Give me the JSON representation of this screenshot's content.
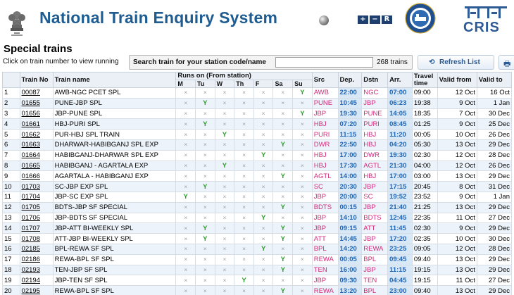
{
  "header": {
    "title": "National Train Enquiry System",
    "font_controls": [
      "+",
      "−",
      "R"
    ],
    "cris_logo_text": "CRIS",
    "ir_logo_text": "INDIAN RAILWAYS",
    "colors": {
      "title": "#1e5c91",
      "station": "#d12b7a",
      "time": "#1e64b4",
      "run_mark": "#2d9c2d"
    }
  },
  "page": {
    "section_title": "Special trains",
    "hint": "Click on train number to view running",
    "search_label": "Search train for your station code/name",
    "search_value": "",
    "search_placeholder": "",
    "train_count": "268 trains",
    "refresh_label": "Refresh List"
  },
  "table": {
    "headers": {
      "sno": "",
      "train_no": "Train No",
      "train_name": "Train name",
      "runs_on": "Runs on (From station)",
      "days": [
        "M",
        "Tu",
        "W",
        "Th",
        "F",
        "Sa",
        "Su"
      ],
      "src": "Src",
      "dep": "Dep.",
      "dstn": "Dstn",
      "arr": "Arr.",
      "travel": "Travel time",
      "valid_from": "Valid from",
      "valid_to": "Valid to"
    },
    "run_symbol": "Y",
    "off_symbol": "×",
    "rows": [
      {
        "sno": "1",
        "no": "00087",
        "name": "AWB-NGC PCET SPL",
        "days": "NNNNNNY",
        "src": "AWB",
        "dep": "22:00",
        "dstn": "NGC",
        "arr": "07:00",
        "travel": "09:00",
        "from": "12 Oct",
        "to": "16 Oct"
      },
      {
        "sno": "2",
        "no": "01655",
        "name": "PUNE-JBP SPL",
        "days": "NYNNNNN",
        "src": "PUNE",
        "dep": "10:45",
        "dstn": "JBP",
        "arr": "06:23",
        "travel": "19:38",
        "from": "9 Oct",
        "to": "1 Jan"
      },
      {
        "sno": "3",
        "no": "01656",
        "name": "JBP-PUNE SPL",
        "days": "NNNNNNY",
        "src": "JBP",
        "dep": "19:30",
        "dstn": "PUNE",
        "arr": "14:05",
        "travel": "18:35",
        "from": "7 Oct",
        "to": "30 Dec"
      },
      {
        "sno": "4",
        "no": "01661",
        "name": "HBJ-PURI SPL",
        "days": "NYNNNNN",
        "src": "HBJ",
        "dep": "07:20",
        "dstn": "PURI",
        "arr": "08:45",
        "travel": "01:25",
        "from": "9 Oct",
        "to": "25 Dec"
      },
      {
        "sno": "5",
        "no": "01662",
        "name": "PUR-HBJ SPL TRAIN",
        "days": "NNYNNNN",
        "src": "PURI",
        "dep": "11:15",
        "dstn": "HBJ",
        "arr": "11:20",
        "travel": "00:05",
        "from": "10 Oct",
        "to": "26 Dec"
      },
      {
        "sno": "6",
        "no": "01663",
        "name": "DHARWAR-HABIBGANJ SPL EXP",
        "days": "NNNNNYN",
        "src": "DWR",
        "dep": "22:50",
        "dstn": "HBJ",
        "arr": "04:20",
        "travel": "05:30",
        "from": "13 Oct",
        "to": "29 Dec"
      },
      {
        "sno": "7",
        "no": "01664",
        "name": "HABIBGANJ-DHARWAR SPL EXP",
        "days": "NNNNYNN",
        "src": "HBJ",
        "dep": "17:00",
        "dstn": "DWR",
        "arr": "19:30",
        "travel": "02:30",
        "from": "12 Oct",
        "to": "28 Dec"
      },
      {
        "sno": "8",
        "no": "01665",
        "name": "HABIBGANJ - AGARTALA EXP",
        "days": "NNYNNNN",
        "src": "HBJ",
        "dep": "17:30",
        "dstn": "AGTL",
        "arr": "21:30",
        "travel": "04:00",
        "from": "12 Oct",
        "to": "26 Dec"
      },
      {
        "sno": "9",
        "no": "01666",
        "name": "AGARTALA - HABIBGANJ EXP",
        "days": "NNNNNYN",
        "src": "AGTL",
        "dep": "14:00",
        "dstn": "HBJ",
        "arr": "17:00",
        "travel": "03:00",
        "from": "13 Oct",
        "to": "29 Dec"
      },
      {
        "sno": "10",
        "no": "01703",
        "name": "SC-JBP EXP SPL",
        "days": "NYNNNNN",
        "src": "SC",
        "dep": "20:30",
        "dstn": "JBP",
        "arr": "17:15",
        "travel": "20:45",
        "from": "8 Oct",
        "to": "31 Dec"
      },
      {
        "sno": "11",
        "no": "01704",
        "name": "JBP-SC EXP SPL",
        "days": "YNNNNNN",
        "src": "JBP",
        "dep": "20:00",
        "dstn": "SC",
        "arr": "19:52",
        "travel": "23:52",
        "from": "9 Oct",
        "to": "1 Jan"
      },
      {
        "sno": "12",
        "no": "01705",
        "name": "BDTS-JBP SF SPECIAL",
        "days": "NNNNNYN",
        "src": "BDTS",
        "dep": "00:15",
        "dstn": "JBP",
        "arr": "21:40",
        "travel": "21:25",
        "from": "13 Oct",
        "to": "29 Dec"
      },
      {
        "sno": "13",
        "no": "01706",
        "name": "JBP-BDTS SF SPECIAL",
        "days": "NNNNYNN",
        "src": "JBP",
        "dep": "14:10",
        "dstn": "BDTS",
        "arr": "12:45",
        "travel": "22:35",
        "from": "11 Oct",
        "to": "27 Dec"
      },
      {
        "sno": "14",
        "no": "01707",
        "name": "JBP-ATT BI-WEEKLY SPL",
        "days": "NYNNNYN",
        "src": "JBP",
        "dep": "09:15",
        "dstn": "ATT",
        "arr": "11:45",
        "travel": "02:30",
        "from": "9 Oct",
        "to": "29 Dec"
      },
      {
        "sno": "15",
        "no": "01708",
        "name": "ATT-JBP BI-WEEKLY SPL",
        "days": "NYNNNYN",
        "src": "ATT",
        "dep": "14:45",
        "dstn": "JBP",
        "arr": "17:20",
        "travel": "02:35",
        "from": "10 Oct",
        "to": "30 Dec"
      },
      {
        "sno": "16",
        "no": "02185",
        "name": "BPL-REWA SF SPL",
        "days": "NNNNYNN",
        "src": "BPL",
        "dep": "14:20",
        "dstn": "REWA",
        "arr": "23:25",
        "travel": "09:05",
        "from": "12 Oct",
        "to": "28 Dec"
      },
      {
        "sno": "17",
        "no": "02186",
        "name": "REWA-BPL SF SPL",
        "days": "NNNNNYN",
        "src": "REWA",
        "dep": "00:05",
        "dstn": "BPL",
        "arr": "09:45",
        "travel": "09:40",
        "from": "13 Oct",
        "to": "29 Dec"
      },
      {
        "sno": "18",
        "no": "02193",
        "name": "TEN-JBP SF SPL",
        "days": "NNNNNYN",
        "src": "TEN",
        "dep": "16:00",
        "dstn": "JBP",
        "arr": "11:15",
        "travel": "19:15",
        "from": "13 Oct",
        "to": "29 Dec"
      },
      {
        "sno": "19",
        "no": "02194",
        "name": "JBP-TEN SF SPL",
        "days": "NNNYNNN",
        "src": "JBP",
        "dep": "09:30",
        "dstn": "TEN",
        "arr": "04:45",
        "travel": "19:15",
        "from": "11 Oct",
        "to": "27 Dec"
      },
      {
        "sno": "20",
        "no": "02195",
        "name": "REWA-BPL SF SPL",
        "days": "NNNNNYN",
        "src": "REWA",
        "dep": "13:20",
        "dstn": "BPL",
        "arr": "23:00",
        "travel": "09:40",
        "from": "13 Oct",
        "to": "29 Dec"
      }
    ]
  }
}
